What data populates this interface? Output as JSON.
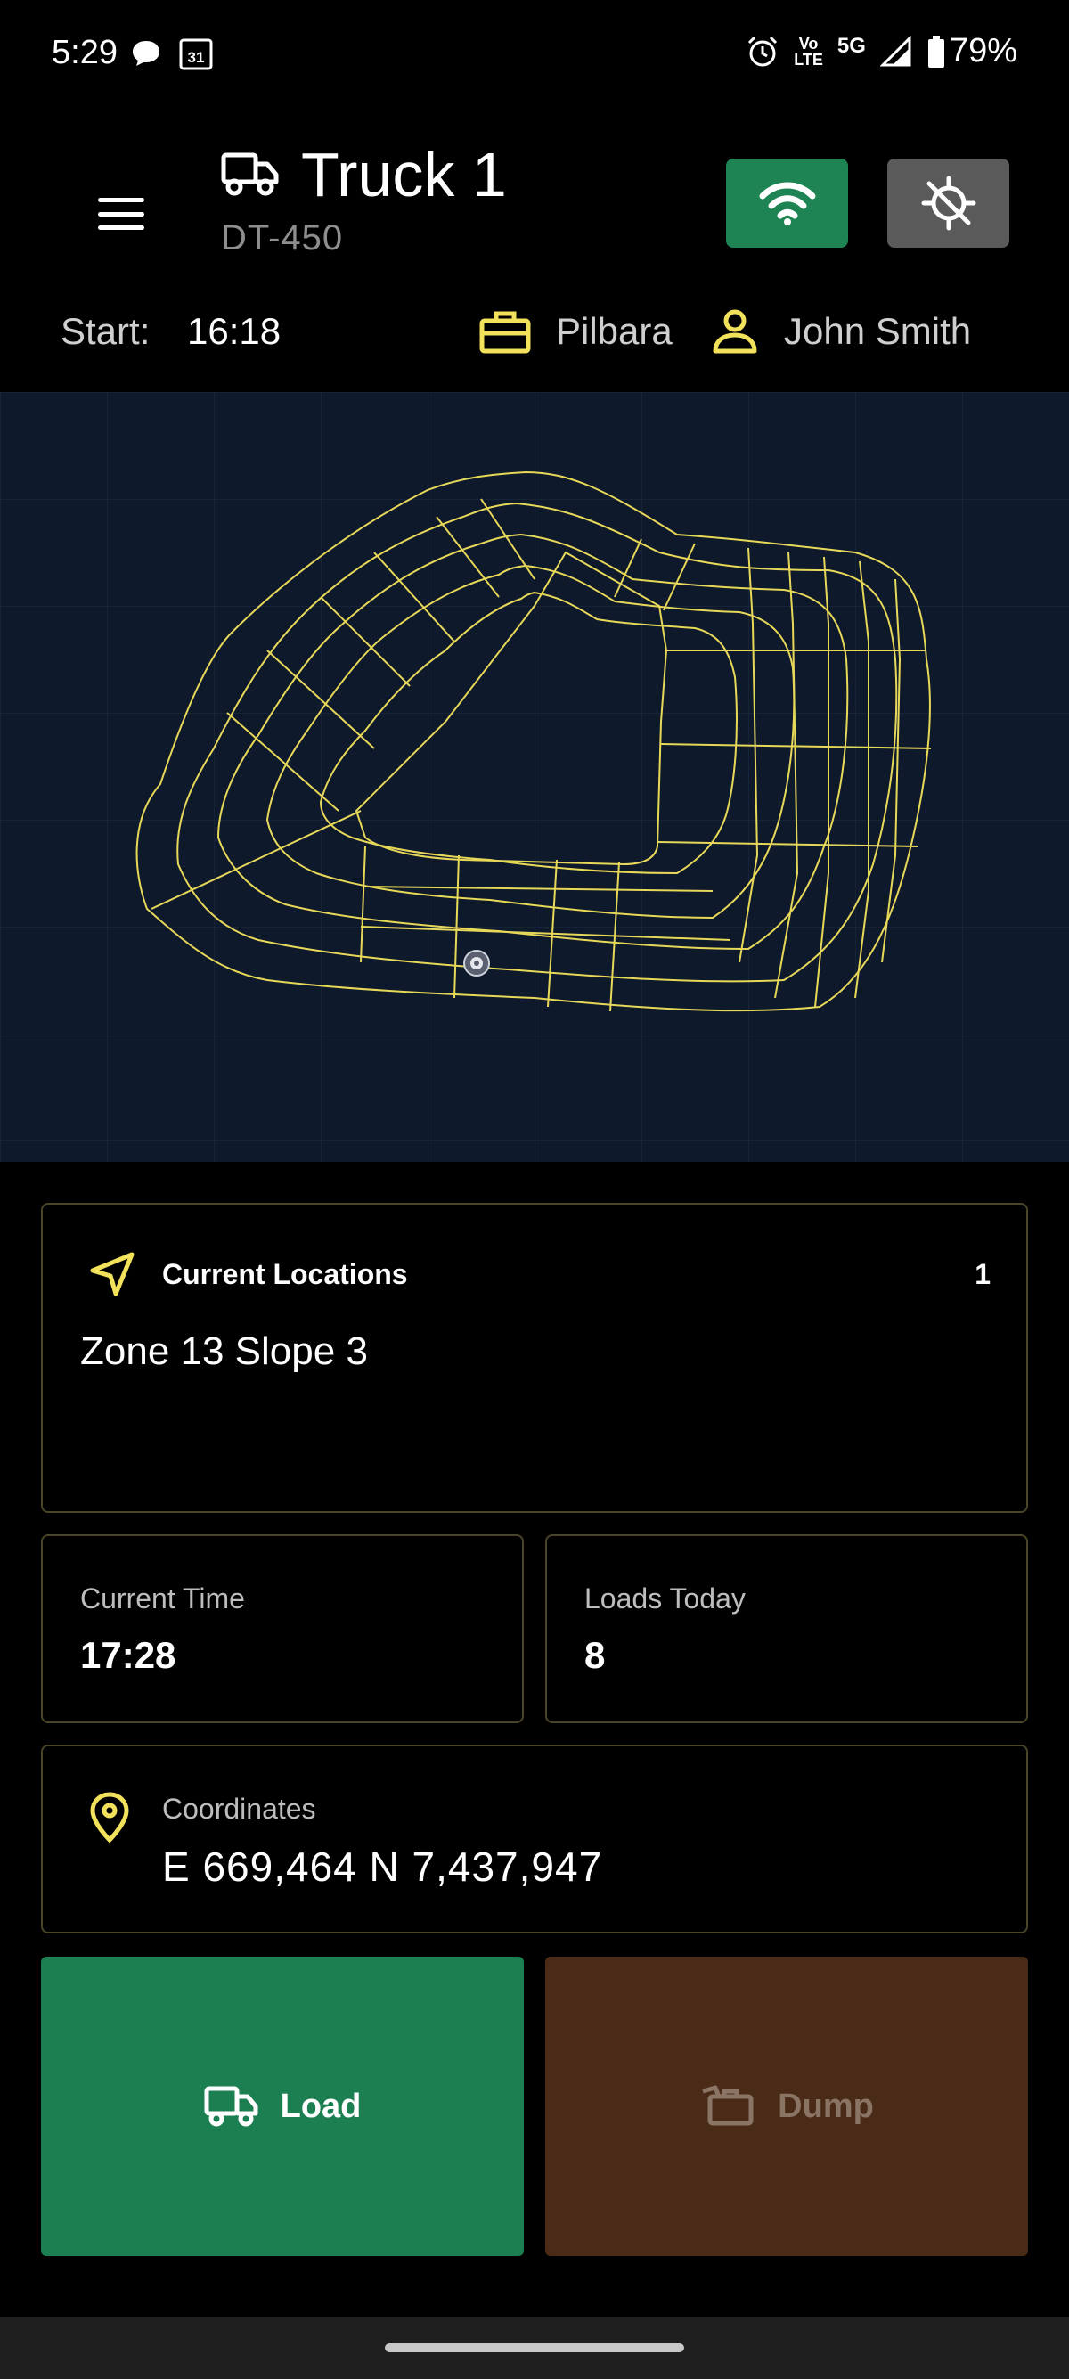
{
  "status_bar": {
    "time": "5:29",
    "calendar_day": "31",
    "volte_top": "Vo",
    "volte_bottom": "LTE",
    "network": "5G",
    "battery": "79%"
  },
  "header": {
    "title": "Truck 1",
    "subtitle": "DT-450",
    "start_label": "Start:",
    "start_time": "16:18",
    "site": "Pilbara",
    "operator": "John Smith"
  },
  "colors": {
    "accent_yellow": "#f2e15a",
    "wifi_green": "#1f8454",
    "load_green": "#1c7f51",
    "dump_brown": "#4a2b17",
    "map_bg": "#0e1a2b"
  },
  "location_card": {
    "label": "Current Locations",
    "count": "1",
    "value": "Zone 13 Slope 3"
  },
  "time_card": {
    "label": "Current Time",
    "value": "17:28"
  },
  "loads_card": {
    "label": "Loads Today",
    "value": "8"
  },
  "coordinates_card": {
    "label": "Coordinates",
    "value": "E 669,464 N 7,437,947"
  },
  "actions": {
    "load_label": "Load",
    "dump_label": "Dump"
  },
  "icons": {
    "menu": "menu-icon",
    "truck": "truck-icon",
    "wifi": "wifi-icon",
    "gps_off": "gps-off-icon",
    "briefcase": "briefcase-icon",
    "user": "user-icon",
    "navigation": "navigation-arrow-icon",
    "pin": "map-pin-icon",
    "dump": "dump-bin-icon"
  }
}
